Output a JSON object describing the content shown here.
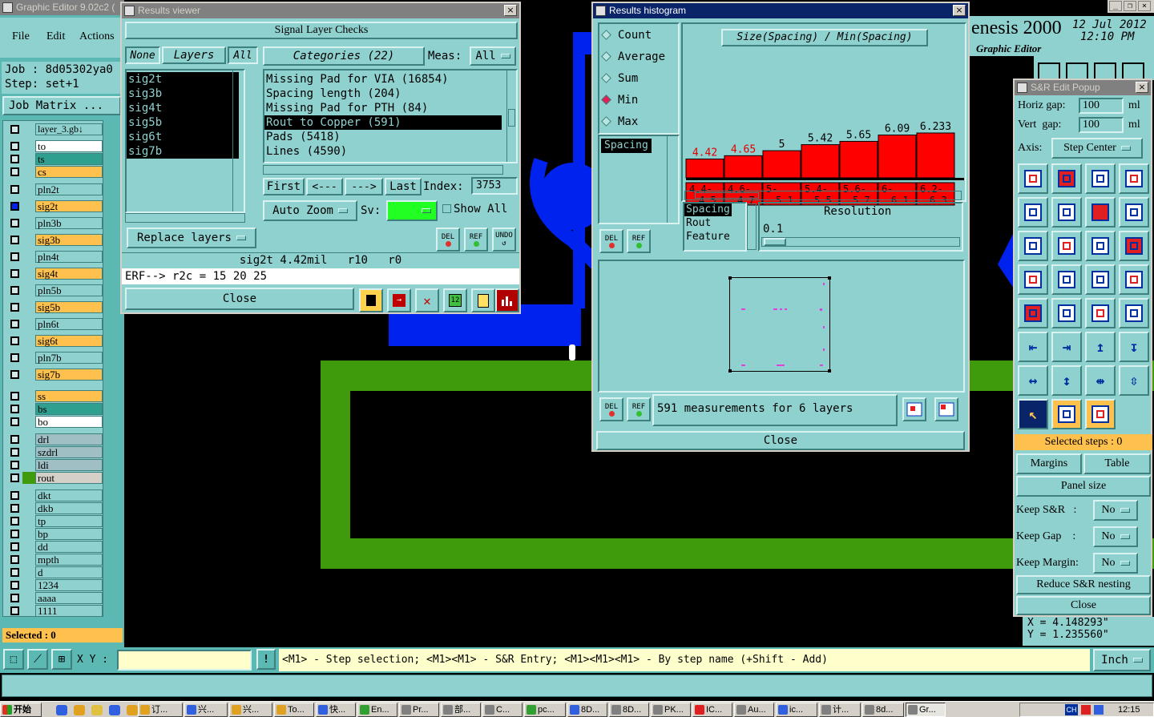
{
  "main_window": {
    "title": "Graphic Editor 9.02c2 (",
    "menu": [
      "File",
      "Edit",
      "Actions"
    ],
    "job_label": "Job : 8d05302ya0",
    "step_label": "Step: set+1",
    "job_matrix": "Job Matrix ...",
    "layer_name": "layer_3.gb↓",
    "product": "enesis 2000",
    "product_sub": "Graphic Editor",
    "date": "12 Jul 2012",
    "time": "12:10 PM",
    "selected": "Selected : 0",
    "xy_label": "X Y :",
    "status_hint": "<M1> - Step selection; <M1><M1> - S&R Entry; <M1><M1><M1> - By step name (+Shift - Add)",
    "units": "Inch",
    "coord_x": "X = 4.148293\"",
    "coord_y": "Y = 1.235560\""
  },
  "layers": [
    {
      "name": "to",
      "color": "#ffffff",
      "active": false
    },
    {
      "name": "ts",
      "color": "#2f9f8f",
      "active": false
    },
    {
      "name": "cs",
      "color": "#ffc14d",
      "active": false
    },
    {
      "name": "pln2t",
      "color": "#8fd1cf",
      "active": false
    },
    {
      "name": "sig2t",
      "color": "#ffc14d",
      "active": true
    },
    {
      "name": "pln3b",
      "color": "#8fd1cf",
      "active": false
    },
    {
      "name": "sig3b",
      "color": "#ffc14d",
      "active": false
    },
    {
      "name": "pln4t",
      "color": "#8fd1cf",
      "active": false
    },
    {
      "name": "sig4t",
      "color": "#ffc14d",
      "active": false
    },
    {
      "name": "pln5b",
      "color": "#8fd1cf",
      "active": false
    },
    {
      "name": "sig5b",
      "color": "#ffc14d",
      "active": false
    },
    {
      "name": "pln6t",
      "color": "#8fd1cf",
      "active": false
    },
    {
      "name": "sig6t",
      "color": "#ffc14d",
      "active": false
    },
    {
      "name": "pln7b",
      "color": "#8fd1cf",
      "active": false
    },
    {
      "name": "sig7b",
      "color": "#ffc14d",
      "active": false
    },
    {
      "name": "ss",
      "color": "#ffc14d",
      "active": false
    },
    {
      "name": "bs",
      "color": "#2f9f8f",
      "active": false
    },
    {
      "name": "bo",
      "color": "#ffffff",
      "active": false
    },
    {
      "name": "drl",
      "color": "#9fbfc5",
      "active": false
    },
    {
      "name": "szdrl",
      "color": "#9fbfc5",
      "active": false
    },
    {
      "name": "ldi",
      "color": "#9fbfc5",
      "active": false
    },
    {
      "name": "rout",
      "color": "#d4d0c8",
      "active": false
    },
    {
      "name": "dkt",
      "color": "#8fd1cf",
      "active": false
    },
    {
      "name": "dkb",
      "color": "#8fd1cf",
      "active": false
    },
    {
      "name": "tp",
      "color": "#8fd1cf",
      "active": false
    },
    {
      "name": "bp",
      "color": "#8fd1cf",
      "active": false
    },
    {
      "name": "dd",
      "color": "#8fd1cf",
      "active": false
    },
    {
      "name": "mpth",
      "color": "#8fd1cf",
      "active": false
    },
    {
      "name": "d",
      "color": "#8fd1cf",
      "active": false
    },
    {
      "name": "1234",
      "color": "#8fd1cf",
      "active": false
    },
    {
      "name": "aaaa",
      "color": "#8fd1cf",
      "active": false
    },
    {
      "name": "1111",
      "color": "#8fd1cf",
      "active": false
    }
  ],
  "results_viewer": {
    "title": "Results viewer",
    "header": "Signal Layer Checks",
    "none_btn": "None",
    "layers_btn": "Layers",
    "all_btn": "All",
    "categories_btn": "Categories (22)",
    "meas_label": "Meas:",
    "meas_value": "All",
    "layer_list": [
      "sig2t",
      "sig3b",
      "sig4t",
      "sig5b",
      "sig6t",
      "sig7b"
    ],
    "categories": [
      {
        "text": "Missing Pad for VIA (16854)",
        "selected": false
      },
      {
        "text": "Spacing length (204)",
        "selected": false
      },
      {
        "text": "Missing Pad for PTH (84)",
        "selected": false
      },
      {
        "text": "Rout to Copper (591)",
        "selected": true
      },
      {
        "text": "Pads (5418)",
        "selected": false
      },
      {
        "text": "Lines (4590)",
        "selected": false
      }
    ],
    "first_btn": "First",
    "prev_btn": "<---",
    "next_btn": "--->",
    "last_btn": "Last",
    "index_label": "Index:",
    "index_value": "3753",
    "auto_zoom": "Auto Zoom",
    "sv_label": "Sv:",
    "show_all": "Show All",
    "replace_layers": "Replace layers",
    "del": "DEL",
    "ref": "REF",
    "undo": "UNDO",
    "status_line": "sig2t 4.42mil   r10   r0",
    "erf_line": "ERF--> r2c = 15 20 25",
    "close": "Close"
  },
  "histogram": {
    "title": "Results histogram",
    "options": [
      {
        "label": "Count",
        "selected": false
      },
      {
        "label": "Average",
        "selected": false
      },
      {
        "label": "Sum",
        "selected": false
      },
      {
        "label": "Min",
        "selected": true
      },
      {
        "label": "Max",
        "selected": false
      }
    ],
    "measure_list": [
      "Spacing"
    ],
    "chart_title": "Size(Spacing) / Min(Spacing)",
    "axis_list": [
      "Spacing",
      "Rout",
      "Feature"
    ],
    "resolution_label": "Resolution",
    "resolution_value": "0.1",
    "summary": "591 measurements for 6 layers",
    "del": "DEL",
    "ref": "REF",
    "close": "Close"
  },
  "chart_data": {
    "type": "bar",
    "title": "Size(Spacing) / Min(Spacing)",
    "categories": [
      "4.4-4.5",
      "4.6-4.7",
      "5-5.1",
      "5.4-5.5",
      "5.6-5.7",
      "6-6.1",
      "6.2-6.3"
    ],
    "category_lines": [
      [
        "4.4-",
        "4.5"
      ],
      [
        "4.6-",
        "4.7"
      ],
      [
        "5-",
        "5.1"
      ],
      [
        "5.4-",
        "5.5"
      ],
      [
        "5.6-",
        "5.7"
      ],
      [
        "6-",
        "6.1"
      ],
      [
        "6.2-",
        "6.3"
      ]
    ],
    "values": [
      4.42,
      4.65,
      5,
      5.42,
      5.65,
      6.09,
      6.233
    ],
    "labels": [
      "4.42",
      "4.65",
      "5",
      "5.42",
      "5.65",
      "6.09",
      "6.233"
    ],
    "label_colors": [
      "#e00000",
      "#e00000",
      "#000000",
      "#000000",
      "#000000",
      "#000000",
      "#000000"
    ],
    "bar_color": "#ff0000"
  },
  "sr_popup": {
    "title": "S&R Edit Popup",
    "horiz_label": "Horiz gap:",
    "horiz_value": "100",
    "horiz_unit": "ml",
    "vert_label": "Vert  gap:",
    "vert_value": "100",
    "vert_unit": "ml",
    "axis_label": "Axis:",
    "axis_value": "Step Center",
    "selected_steps": "Selected steps : 0",
    "margins": "Margins",
    "table": "Table",
    "panel_size": "Panel size",
    "keep_sr_label": "Keep S&R   :",
    "keep_sr_value": "No",
    "keep_gap_label": "Keep Gap    :",
    "keep_gap_value": "No",
    "keep_margin_label": "Keep Margin:",
    "keep_margin_value": "No",
    "reduce": "Reduce S&R nesting",
    "close": "Close"
  },
  "taskbar": {
    "start": "开始",
    "items": [
      "订...",
      "兴...",
      "兴...",
      "To...",
      "快...",
      "En...",
      "Pr...",
      "部...",
      "C...",
      "pc...",
      "8D...",
      "8D...",
      "PK...",
      "IC...",
      "Au...",
      "ic...",
      "计...",
      "8d...",
      "Gr..."
    ],
    "clock": "12:15",
    "lang": "CH"
  },
  "colors": {
    "panel": "#8fd1cf",
    "canvas": "#000000",
    "copper": "#0022ee",
    "outline": "#3f9b0b",
    "accent": "#ffc14d"
  }
}
